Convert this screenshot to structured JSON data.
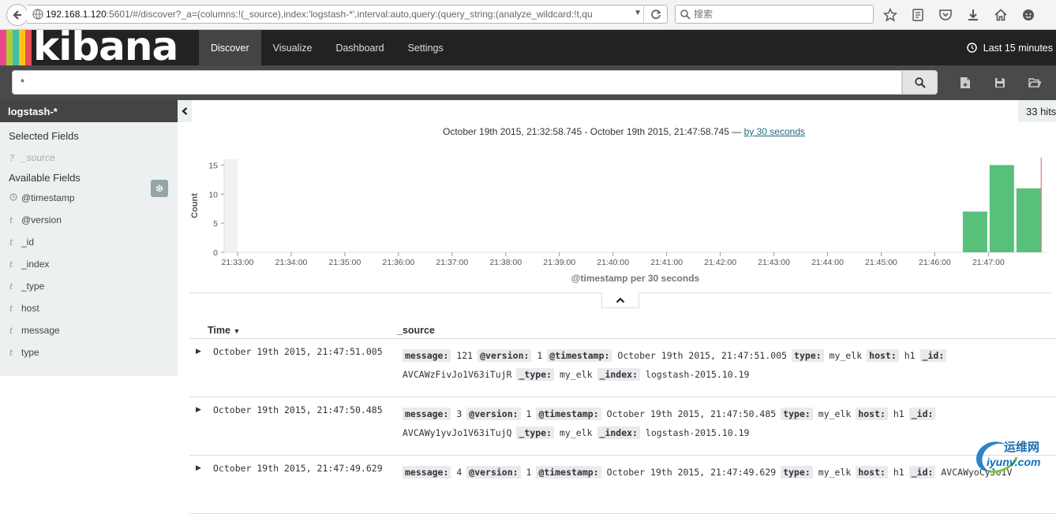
{
  "browser": {
    "url_host": "192.168.1.120",
    "url_rest": ":5601/#/discover?_a=(columns:!(_source),index:'logstash-*',interval:auto,query:(query_string:(analyze_wildcard:!t,qu",
    "search_placeholder": "搜索"
  },
  "kibana": {
    "logo": "kibana",
    "stripe_colors": [
      "#e8488b",
      "#b0cd37",
      "#3ebeb0",
      "#fec514",
      "#ea4e58"
    ],
    "tabs": [
      {
        "label": "Discover",
        "active": true
      },
      {
        "label": "Visualize",
        "active": false
      },
      {
        "label": "Dashboard",
        "active": false
      },
      {
        "label": "Settings",
        "active": false
      }
    ],
    "time_label": "Last 15 minutes"
  },
  "query": {
    "value": "*"
  },
  "sidebar": {
    "index_pattern": "logstash-*",
    "selected_heading": "Selected Fields",
    "selected_fields": [
      {
        "type": "?",
        "name": "_source"
      }
    ],
    "available_heading": "Available Fields",
    "available_fields": [
      {
        "type": "clock",
        "name": "@timestamp"
      },
      {
        "type": "t",
        "name": "@version"
      },
      {
        "type": "t",
        "name": "_id"
      },
      {
        "type": "t",
        "name": "_index"
      },
      {
        "type": "t",
        "name": "_type"
      },
      {
        "type": "t",
        "name": "host"
      },
      {
        "type": "t",
        "name": "message"
      },
      {
        "type": "t",
        "name": "type"
      }
    ]
  },
  "hits_label": "33 hits",
  "range": {
    "text": "October 19th 2015, 21:32:58.745 - October 19th 2015, 21:47:58.745 — ",
    "interval_link": "by 30 seconds"
  },
  "chart_data": {
    "type": "bar",
    "ylabel": "Count",
    "xlabel": "@timestamp per 30 seconds",
    "ylim": [
      0,
      16
    ],
    "yticks": [
      0,
      5,
      10,
      15
    ],
    "xlim": [
      "21:32:45",
      "21:48:05"
    ],
    "xticks": [
      "21:33:00",
      "21:34:00",
      "21:35:00",
      "21:36:00",
      "21:37:00",
      "21:38:00",
      "21:39:00",
      "21:40:00",
      "21:41:00",
      "21:42:00",
      "21:43:00",
      "21:44:00",
      "21:45:00",
      "21:46:00",
      "21:47:00"
    ],
    "bars": [
      {
        "start": "21:46:30",
        "value": 7
      },
      {
        "start": "21:47:00",
        "value": 15
      },
      {
        "start": "21:47:30",
        "value": 11
      }
    ],
    "bar_color": "#57c17b",
    "partial_bucket": {
      "start": "21:32:45",
      "end": "21:33:00"
    },
    "now_marker": "21:47:59"
  },
  "table": {
    "col_time": "Time",
    "col_source": "_source",
    "rows": [
      {
        "time": "October 19th 2015, 21:47:51.005",
        "fields": [
          {
            "k": "message:",
            "v": "121"
          },
          {
            "k": "@version:",
            "v": "1"
          },
          {
            "k": "@timestamp:",
            "v": "October 19th 2015, 21:47:51.005"
          },
          {
            "k": "type:",
            "v": "my_elk"
          },
          {
            "k": "host:",
            "v": "h1"
          },
          {
            "k": "_id:",
            "v": "AVCAWzFivJo1V63iTujR"
          },
          {
            "k": "_type:",
            "v": "my_elk"
          },
          {
            "k": "_index:",
            "v": "logstash-2015.10.19"
          }
        ]
      },
      {
        "time": "October 19th 2015, 21:47:50.485",
        "fields": [
          {
            "k": "message:",
            "v": "3"
          },
          {
            "k": "@version:",
            "v": "1"
          },
          {
            "k": "@timestamp:",
            "v": "October 19th 2015, 21:47:50.485"
          },
          {
            "k": "type:",
            "v": "my_elk"
          },
          {
            "k": "host:",
            "v": "h1"
          },
          {
            "k": "_id:",
            "v": "AVCAWy1yvJo1V63iTujQ"
          },
          {
            "k": "_type:",
            "v": "my_elk"
          },
          {
            "k": "_index:",
            "v": "logstash-2015.10.19"
          }
        ]
      },
      {
        "time": "October 19th 2015, 21:47:49.629",
        "fields": [
          {
            "k": "message:",
            "v": "4"
          },
          {
            "k": "@version:",
            "v": "1"
          },
          {
            "k": "@timestamp:",
            "v": "October 19th 2015, 21:47:49.629"
          },
          {
            "k": "type:",
            "v": "my_elk"
          },
          {
            "k": "host:",
            "v": "h1"
          },
          {
            "k": "_id:",
            "v": "AVCAWyoCyJo1V"
          }
        ]
      }
    ]
  },
  "watermark": {
    "cn": "运维网",
    "url": "iyunv.com"
  }
}
